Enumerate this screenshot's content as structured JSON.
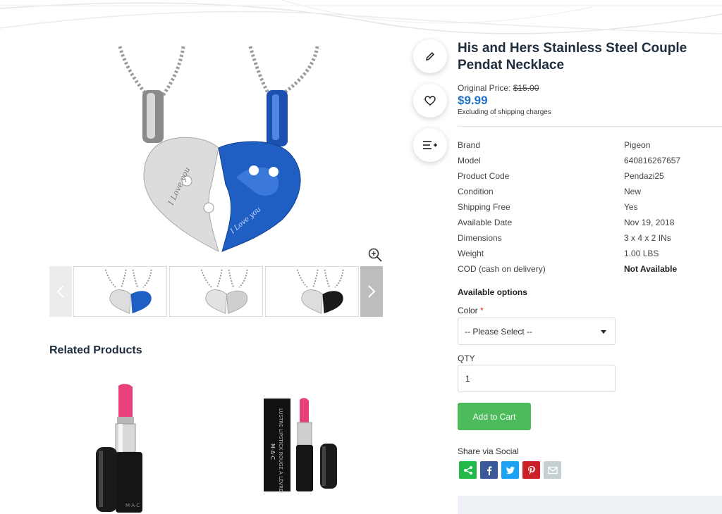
{
  "product": {
    "title": "His and Hers Stainless Steel Couple Pendat Necklace",
    "original_price_label": "Original Price:",
    "original_price": "$15.00",
    "price": "$9.99",
    "shipping_note": "Excluding of shipping charges"
  },
  "specs": [
    {
      "label": "Brand",
      "value": "Pigeon"
    },
    {
      "label": "Model",
      "value": "640816267657"
    },
    {
      "label": "Product Code",
      "value": "Pendazi25"
    },
    {
      "label": "Condition",
      "value": "New"
    },
    {
      "label": "Shipping Free",
      "value": "Yes"
    },
    {
      "label": "Available Date",
      "value": "Nov 19, 2018"
    },
    {
      "label": "Dimensions",
      "value": "3 x 4 x 2 INs"
    },
    {
      "label": "Weight",
      "value": "1.00 LBS"
    },
    {
      "label": "COD (cash on delivery)",
      "value": "Not Available"
    }
  ],
  "options": {
    "title": "Available options",
    "color_label": "Color",
    "required_mark": "*",
    "color_selected": "-- Please Select --",
    "qty_label": "QTY",
    "qty_value": "1"
  },
  "cart_button": "Add to Cart",
  "share": {
    "title": "Share via Social",
    "networks": [
      "share-icon",
      "facebook-icon",
      "twitter-icon",
      "pinterest-icon",
      "email-icon"
    ]
  },
  "related": {
    "title": "Related Products"
  },
  "side_actions": [
    "pencil-icon",
    "heart-icon",
    "add-to-list-icon"
  ],
  "colors": {
    "price": "#2172c9",
    "cart_button": "#4cbb5b",
    "blue_pendant": "#1f5fc4",
    "lipstick_pink": "#e83e8c",
    "required": "#e02424"
  }
}
